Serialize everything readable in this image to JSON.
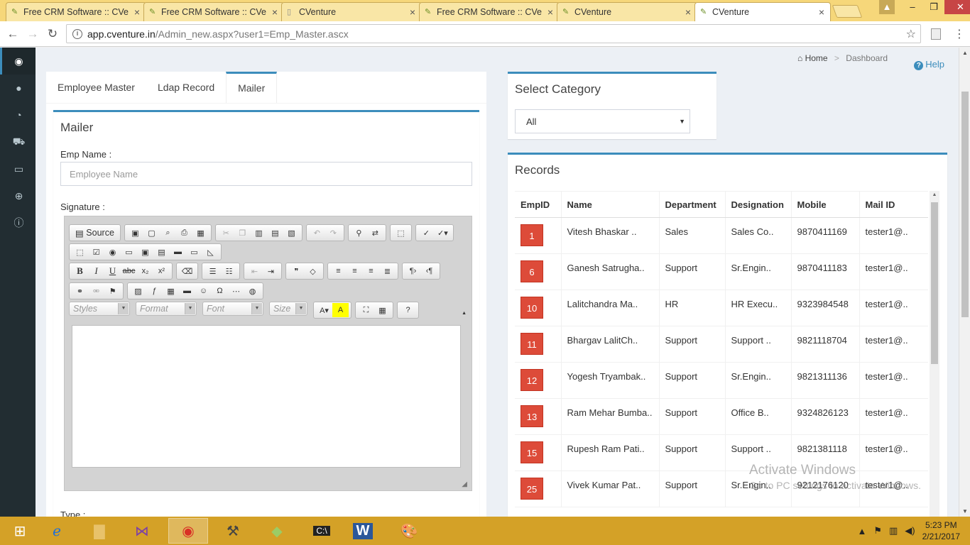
{
  "browser": {
    "tabs": [
      {
        "title": "Free CRM Software :: CVe",
        "icon": "leaf-icon",
        "active": false
      },
      {
        "title": "Free CRM Software :: CVe",
        "icon": "leaf-icon",
        "active": false
      },
      {
        "title": "CVenture",
        "icon": "page-icon",
        "active": false
      },
      {
        "title": "Free CRM Software :: CVe",
        "icon": "leaf-icon",
        "active": false
      },
      {
        "title": "CVenture",
        "icon": "leaf-icon",
        "active": false
      },
      {
        "title": "CVenture",
        "icon": "leaf-icon",
        "active": true
      }
    ],
    "url_host": "app.cventure.in",
    "url_path": "/Admin_new.aspx?user1=Emp_Master.ascx"
  },
  "breadcrumb": {
    "home": "Home",
    "current": "Dashboard"
  },
  "help_label": "Help",
  "left_tabs": [
    "Employee Master",
    "Ldap Record",
    "Mailer"
  ],
  "mailer": {
    "title": "Mailer",
    "emp_name_label": "Emp Name :",
    "emp_name_placeholder": "Employee Name",
    "signature_label": "Signature :",
    "type_label": "Type :",
    "toolbar": {
      "source_label": "Source",
      "styles": "Styles",
      "format": "Format",
      "font": "Font",
      "size": "Size"
    }
  },
  "category": {
    "title": "Select Category",
    "selected": "All"
  },
  "records": {
    "title": "Records",
    "columns": [
      "EmpID",
      "Name",
      "Department",
      "Designation",
      "Mobile",
      "Mail ID"
    ],
    "rows": [
      {
        "id": "1",
        "name": "Vitesh Bhaskar ..",
        "dept": "Sales",
        "desig": "Sales Co..",
        "mobile": "9870411169",
        "mail": "tester1@.."
      },
      {
        "id": "6",
        "name": "Ganesh Satrugha..",
        "dept": "Support",
        "desig": "Sr.Engin..",
        "mobile": "9870411183",
        "mail": "tester1@.."
      },
      {
        "id": "10",
        "name": "Lalitchandra Ma..",
        "dept": "HR",
        "desig": "HR Execu..",
        "mobile": "9323984548",
        "mail": "tester1@.."
      },
      {
        "id": "11",
        "name": "Bhargav LalitCh..",
        "dept": "Support",
        "desig": "Support ..",
        "mobile": "9821118704",
        "mail": "tester1@.."
      },
      {
        "id": "12",
        "name": "Yogesh Tryambak..",
        "dept": "Support",
        "desig": "Sr.Engin..",
        "mobile": "9821311136",
        "mail": "tester1@.."
      },
      {
        "id": "13",
        "name": "Ram Mehar Bumba..",
        "dept": "Support",
        "desig": "Office B..",
        "mobile": "9324826123",
        "mail": "tester1@.."
      },
      {
        "id": "15",
        "name": "Rupesh Ram Pati..",
        "dept": "Support",
        "desig": "Support ..",
        "mobile": "9821381118",
        "mail": "tester1@.."
      },
      {
        "id": "25",
        "name": "Vivek Kumar Pat..",
        "dept": "Support",
        "desig": "Sr.Engin..",
        "mobile": "9212176120",
        "mail": "tester1@.."
      }
    ]
  },
  "watermark": {
    "line1": "Activate Windows",
    "line2": "Go to PC settings to activate Windows."
  },
  "clock": {
    "time": "5:23 PM",
    "date": "2/21/2017"
  },
  "colors": {
    "accent": "#3c8dbc",
    "badge": "#dd4b39",
    "sidebar": "#222d32",
    "taskbar": "#d4a127"
  }
}
